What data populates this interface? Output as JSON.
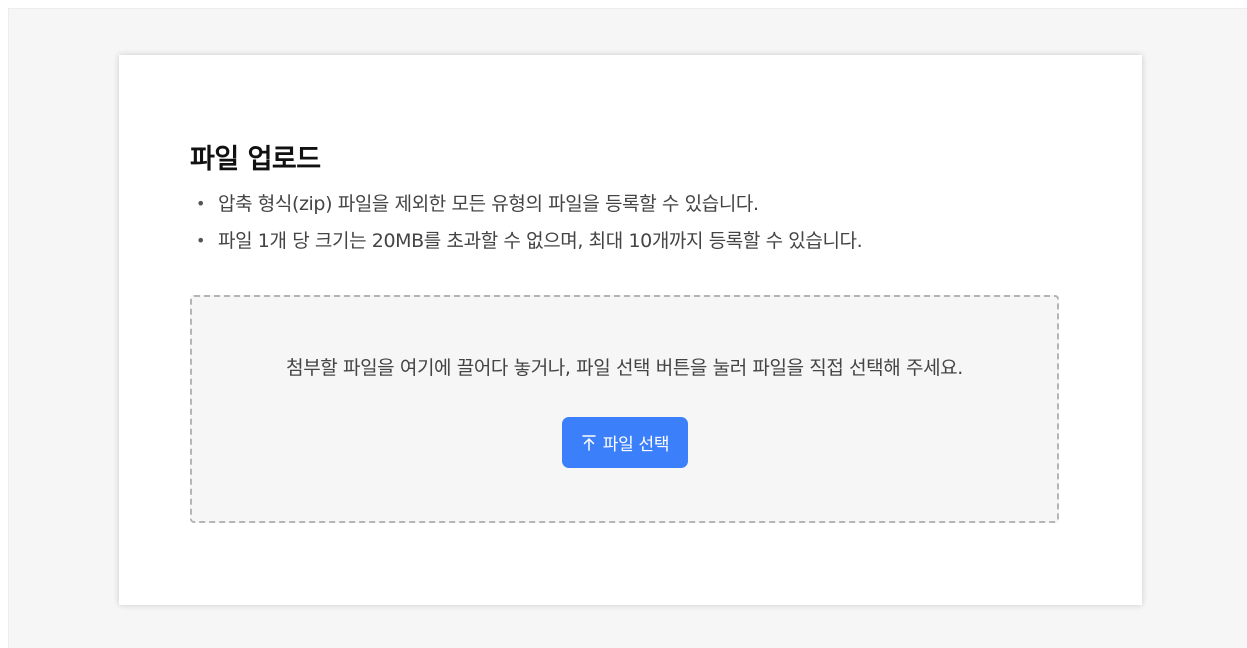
{
  "upload": {
    "title": "파일 업로드",
    "notes": [
      {
        "bullet": "•",
        "text": "압축 형식(zip) 파일을 제외한 모든 유형의 파일을 등록할 수 있습니다."
      },
      {
        "bullet": "•",
        "text": "파일 1개 당 크기는 20MB를 초과할 수 없으며, 최대 10개까지 등록할 수 있습니다."
      }
    ],
    "dropzone": {
      "text": "첨부할 파일을 여기에 끌어다 놓거나, 파일 선택 버튼을 눌러 파일을 직접 선택해 주세요.",
      "button_label": "파일 선택",
      "button_icon": "upload-arrow-icon"
    }
  },
  "colors": {
    "page_background": "#f6f6f6",
    "card_background": "#ffffff",
    "accent": "#3c7ffb",
    "dropzone_border": "#b5b5b5",
    "title_text": "#111111",
    "body_text": "#444444"
  }
}
